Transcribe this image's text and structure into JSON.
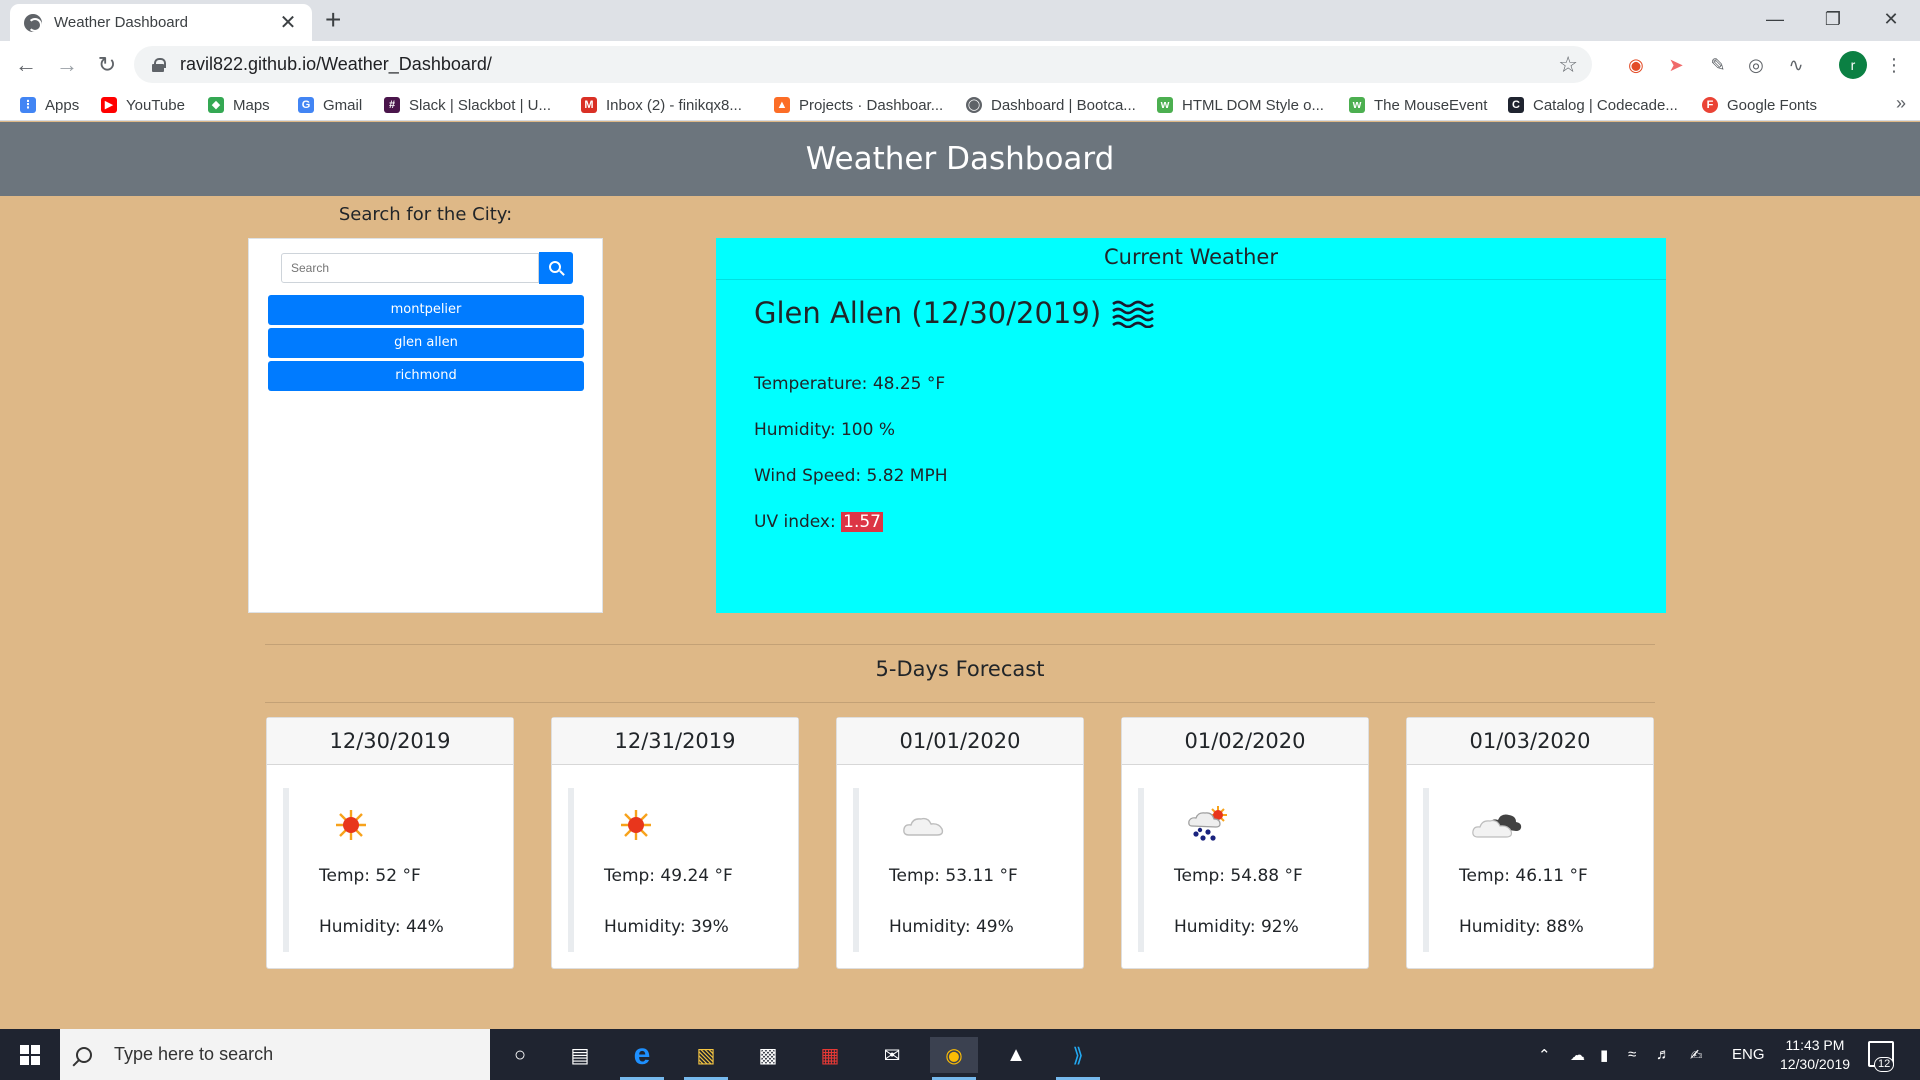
{
  "browser": {
    "tab_title": "Weather Dashboard",
    "tab_close": "✕",
    "new_tab": "+",
    "url": "ravil822.github.io/Weather_Dashboard/",
    "profile_initial": "r",
    "window_controls": {
      "minimize": "—",
      "maximize": "❐",
      "close": "✕"
    },
    "bookmarks": [
      {
        "label": "Apps",
        "icon": "apps-grid-icon",
        "color": "#4285f4"
      },
      {
        "label": "YouTube",
        "icon": "youtube-icon",
        "color": "#ff0000"
      },
      {
        "label": "Maps",
        "icon": "maps-icon",
        "color": "#34a853"
      },
      {
        "label": "Gmail",
        "icon": "google-g-icon",
        "color": "#4285f4"
      },
      {
        "label": "Slack | Slackbot | U...",
        "icon": "slack-icon",
        "color": "#4a154b"
      },
      {
        "label": "Inbox (2) - finikqx8...",
        "icon": "gmail-icon",
        "color": "#d93025"
      },
      {
        "label": "Projects · Dashboar...",
        "icon": "gitlab-icon",
        "color": "#fc6d26"
      },
      {
        "label": "Dashboard | Bootca...",
        "icon": "globe-icon",
        "color": "#5f6368"
      },
      {
        "label": "HTML DOM Style o...",
        "icon": "w3schools-icon",
        "color": "#4caf50"
      },
      {
        "label": "The MouseEvent",
        "icon": "w3schools-icon",
        "color": "#4caf50"
      },
      {
        "label": "Catalog | Codecade...",
        "icon": "codecademy-icon",
        "color": "#1f2430"
      },
      {
        "label": "Google Fonts",
        "icon": "google-fonts-icon",
        "color": "#ea4335"
      }
    ],
    "bookmarks_more": "»"
  },
  "page": {
    "header_title": "Weather Dashboard",
    "search_title": "Search for the City:",
    "search_placeholder": "Search",
    "cities": [
      "montpelier",
      "glen allen",
      "richmond"
    ],
    "current": {
      "heading": "Current Weather",
      "city_line": "Glen Allen (12/30/2019)",
      "temperature": "Temperature: 48.25 °F",
      "humidity": "Humidity: 100 %",
      "wind": "Wind Speed: 5.82 MPH",
      "uv_label": "UV index:",
      "uv_value": "1.57",
      "icon": "mist-waves-icon"
    },
    "forecast_title": "5-Days Forecast",
    "forecast": [
      {
        "date": "12/30/2019",
        "temp": "Temp: 52 °F",
        "humidity": "Humidity: 44%",
        "icon": "sun-icon"
      },
      {
        "date": "12/31/2019",
        "temp": "Temp: 49.24 °F",
        "humidity": "Humidity: 39%",
        "icon": "sun-icon"
      },
      {
        "date": "01/01/2020",
        "temp": "Temp: 53.11 °F",
        "humidity": "Humidity: 49%",
        "icon": "cloud-icon"
      },
      {
        "date": "01/02/2020",
        "temp": "Temp: 54.88 °F",
        "humidity": "Humidity: 92%",
        "icon": "rain-sun-icon"
      },
      {
        "date": "01/03/2020",
        "temp": "Temp: 46.11 °F",
        "humidity": "Humidity: 88%",
        "icon": "dark-cloud-icon"
      }
    ]
  },
  "taskbar": {
    "search_placeholder": "Type here to search",
    "language": "ENG",
    "time": "11:43 PM",
    "date": "12/30/2019",
    "notification_count": "12"
  },
  "colors": {
    "page_background": "#deb887",
    "header_background": "#6c757d",
    "current_weather_background": "#00ffff",
    "button_primary": "#007bff",
    "uv_badge": "#dc3545"
  }
}
